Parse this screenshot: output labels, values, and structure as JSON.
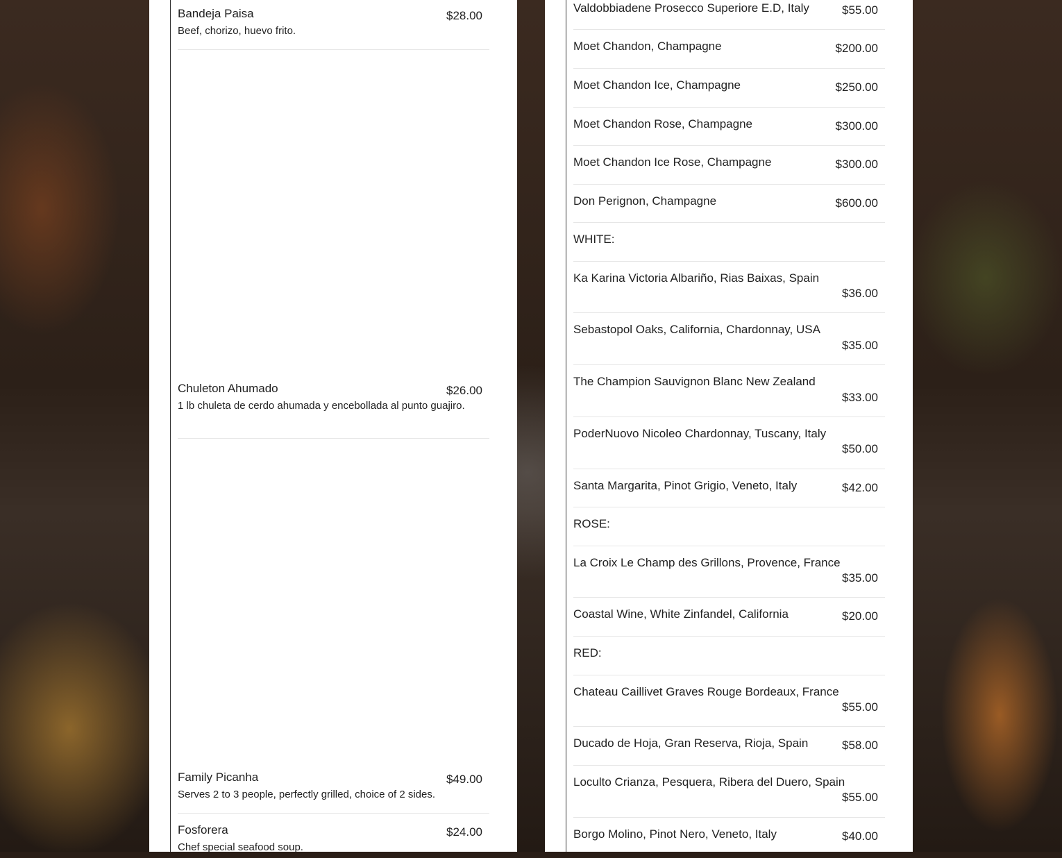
{
  "left_menu": [
    {
      "name": "Bandeja Paisa",
      "price": "$28.00",
      "desc": "Beef, chorizo, huevo frito."
    },
    {
      "name": "Chuleton Ahumado",
      "price": "$26.00",
      "desc": "1 lb chuleta de cerdo ahumada y encebollada al punto guajiro."
    },
    {
      "name": "Family Picanha",
      "price": "$49.00",
      "desc": "Serves 2 to 3 people, perfectly grilled, choice of 2 sides."
    },
    {
      "name": "Fosforera",
      "price": "$24.00",
      "desc": "Chef special seafood soup."
    }
  ],
  "right_menu": [
    {
      "name": "Valdobbiadene Prosecco Superiore E.D, Italy",
      "price": "$55.00"
    },
    {
      "name": "Moet Chandon, Champagne",
      "price": "$200.00"
    },
    {
      "name": "Moet Chandon Ice, Champagne",
      "price": "$250.00"
    },
    {
      "name": "Moet Chandon Rose, Champagne",
      "price": "$300.00"
    },
    {
      "name": "Moet Chandon Ice Rose, Champagne",
      "price": "$300.00"
    },
    {
      "name": "Don Perignon, Champagne",
      "price": "$600.00"
    },
    {
      "name": "WHITE:",
      "price": ""
    },
    {
      "name": "Ka Karina Victoria Albariño, Rias Baixas, Spain",
      "price": "$36.00"
    },
    {
      "name": "Sebastopol Oaks, California, Chardonnay, USA",
      "price": "$35.00"
    },
    {
      "name": "The Champion Sauvignon Blanc New Zealand",
      "price": "$33.00"
    },
    {
      "name": "PoderNuovo Nicoleo Chardonnay, Tuscany, Italy",
      "price": "$50.00"
    },
    {
      "name": "Santa Margarita, Pinot Grigio, Veneto, Italy",
      "price": "$42.00"
    },
    {
      "name": "ROSE:",
      "price": ""
    },
    {
      "name": "La Croix Le Champ des Grillons, Provence, France",
      "price": "$35.00"
    },
    {
      "name": "Coastal Wine, White Zinfandel, California",
      "price": "$20.00"
    },
    {
      "name": "RED:",
      "price": ""
    },
    {
      "name": "Chateau Caillivet Graves Rouge Bordeaux, France",
      "price": "$55.00"
    },
    {
      "name": "Ducado de Hoja, Gran Reserva, Rioja, Spain",
      "price": "$58.00"
    },
    {
      "name": "Loculto Crianza, Pesquera, Ribera del Duero, Spain",
      "price": "$55.00"
    },
    {
      "name": "Borgo Molino, Pinot Nero, Veneto, Italy",
      "price": "$40.00"
    }
  ]
}
